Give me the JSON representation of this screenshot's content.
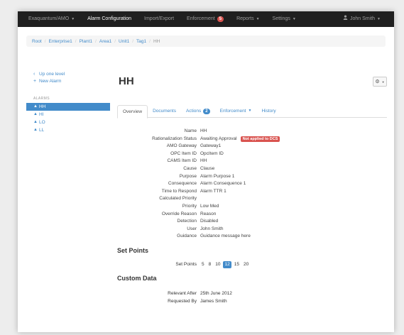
{
  "navbar": {
    "brand": "Exaquantum/AMO",
    "items": [
      {
        "label": "Alarm Configuration",
        "active": true,
        "caret": false
      },
      {
        "label": "Import/Export",
        "active": false,
        "caret": false
      },
      {
        "label": "Enforcement",
        "active": false,
        "caret": false,
        "badge": "5"
      },
      {
        "label": "Reports",
        "active": false,
        "caret": true
      },
      {
        "label": "Settings",
        "active": false,
        "caret": true
      }
    ],
    "user": "John Smith"
  },
  "breadcrumb": {
    "items": [
      "Root",
      "Enterprise1",
      "Plant1",
      "Area1",
      "Unit1",
      "Tag1"
    ],
    "current": "HH"
  },
  "sidebar": {
    "up_label": "Up one level",
    "new_label": "New Alarm",
    "header": "ALARMS",
    "alarms": [
      "HH",
      "HI",
      "LO",
      "LL"
    ],
    "active_index": 0
  },
  "main": {
    "title": "HH",
    "tabs": [
      {
        "label": "Overview",
        "active": true
      },
      {
        "label": "Documents",
        "active": false
      },
      {
        "label": "Actions",
        "active": false,
        "badge": "2"
      },
      {
        "label": "Enforcement",
        "active": false,
        "caret": true
      },
      {
        "label": "History",
        "active": false
      }
    ],
    "details": [
      {
        "label": "Name",
        "value": "HH"
      },
      {
        "label": "Rationalization Status",
        "value": "Awaiting Approval",
        "tag": "Not applied to DCS"
      },
      {
        "label": "AMO Gateway",
        "value": "Gateway1"
      },
      {
        "label": "OPC Item ID",
        "value": "OpcItem ID"
      },
      {
        "label": "CAMS Item ID",
        "value": "HH"
      },
      {
        "label": "Cause",
        "value": "Clause"
      },
      {
        "label": "Purpose",
        "value": "Alarm Purpose 1"
      },
      {
        "label": "Consequence",
        "value": "Alarm Consequence 1"
      },
      {
        "label": "Time to Respond",
        "value": "Alarm TTR 1"
      },
      {
        "label": "Calculated Priority",
        "value": ""
      },
      {
        "label": "Priority",
        "value": "Low Med"
      },
      {
        "label": "Override Reason",
        "value": "Reason"
      },
      {
        "label": "Detection",
        "value": "Disabled"
      },
      {
        "label": "User",
        "value": "John Smith"
      },
      {
        "label": "Guidance",
        "value": "Guidance message here"
      }
    ],
    "set_points": {
      "heading": "Set Points",
      "label": "Set Points",
      "values": [
        "5",
        "8",
        "10",
        "12",
        "15",
        "20"
      ],
      "selected_index": 3
    },
    "custom_data": {
      "heading": "Custom Data",
      "rows": [
        {
          "label": "Relevant After",
          "value": "25th June 2012"
        },
        {
          "label": "Requested By",
          "value": "James Smith"
        }
      ]
    }
  }
}
